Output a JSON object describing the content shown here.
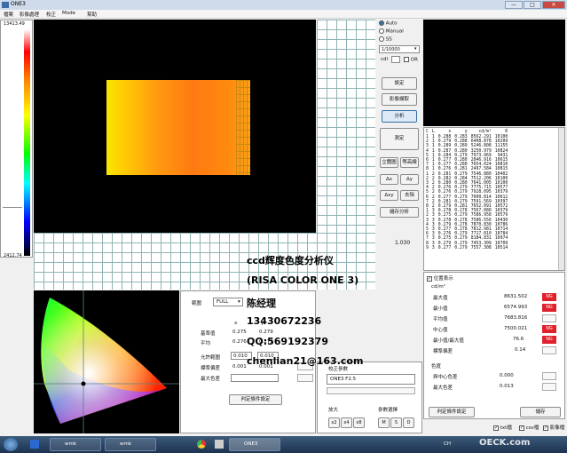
{
  "window": {
    "title": "ONE3",
    "min": "—",
    "max": "□",
    "close": "✕"
  },
  "menu": [
    "檔案",
    "影像處理",
    "校正",
    "Mode",
    "幫助"
  ],
  "scale": {
    "top": "13413.49",
    "bottom": "2412.74"
  },
  "mode": {
    "auto": "Auto",
    "manual": "Manual",
    "ss": "SS",
    "exposure": "1/10000",
    "cdl": "cdl",
    "or": "OR"
  },
  "buttons": {
    "set": "設定",
    "capture": "影像擷取",
    "analyze": "分析",
    "measure": "測定",
    "stereo": "立體圖",
    "contour": "等高線",
    "dx": "Δx",
    "dy": "Δy",
    "dxy": "Δxy",
    "delete": "去除",
    "save_img": "儲存分析",
    "custom_calc": "判定條件設定",
    "save": "儲存",
    "range_set": "判定條件設定"
  },
  "ratio": "1.030",
  "table": {
    "headers": [
      "C",
      "L",
      "x",
      "y",
      "cd/m²",
      "K"
    ],
    "rows": [
      [
        "1",
        "1",
        "0.288",
        "0.283",
        "8562.291",
        "10100"
      ],
      [
        "2",
        "1",
        "0.279",
        "0.288",
        "6408.878",
        "10209"
      ],
      [
        "3",
        "1",
        "0.289",
        "0.289",
        "5246.808",
        "11155"
      ],
      [
        "4",
        "1",
        "0.287",
        "0.280",
        "3250.979",
        "10824"
      ],
      [
        "5",
        "1",
        "0.284",
        "0.279",
        "7973.969",
        "9431"
      ],
      [
        "6",
        "1",
        "0.277",
        "0.280",
        "2846.916",
        "10615"
      ],
      [
        "7",
        "1",
        "0.277",
        "0.280",
        "7654.024",
        "10810"
      ],
      [
        "8",
        "1",
        "0.276",
        "0.281",
        "2497.584",
        "10815"
      ],
      [
        "1",
        "2",
        "0.281",
        "0.279",
        "7546.880",
        "10402"
      ],
      [
        "2",
        "2",
        "0.282",
        "0.284",
        "7512.206",
        "10100"
      ],
      [
        "3",
        "2",
        "0.280",
        "0.280",
        "7641.005",
        "10100"
      ],
      [
        "4",
        "2",
        "0.276",
        "0.279",
        "7775.715",
        "10577"
      ],
      [
        "5",
        "2",
        "0.276",
        "0.279",
        "7928.095",
        "10379"
      ],
      [
        "6",
        "2",
        "0.277",
        "0.279",
        "7600.814",
        "10612"
      ],
      [
        "7",
        "2",
        "0.281",
        "0.279",
        "7591.569",
        "10397"
      ],
      [
        "8",
        "2",
        "0.279",
        "0.281",
        "7652.091",
        "10572"
      ],
      [
        "1",
        "3",
        "0.278",
        "0.278",
        "7567.080",
        "10379"
      ],
      [
        "2",
        "3",
        "0.275",
        "0.279",
        "7586.958",
        "10579"
      ],
      [
        "3",
        "3",
        "0.278",
        "0.278",
        "7586.556",
        "10430"
      ],
      [
        "4",
        "3",
        "0.279",
        "0.278",
        "7870.830",
        "10786"
      ],
      [
        "5",
        "3",
        "0.277",
        "0.278",
        "7812.981",
        "10714"
      ],
      [
        "6",
        "3",
        "0.276",
        "0.279",
        "7717.810",
        "10784"
      ],
      [
        "7",
        "3",
        "0.275",
        "0.279",
        "8184.831",
        "10974"
      ],
      [
        "8",
        "3",
        "0.279",
        "0.279",
        "7453.309",
        "10709"
      ],
      [
        "9",
        "3",
        "0.277",
        "0.279",
        "7557.308",
        "10514"
      ]
    ]
  },
  "stats": {
    "show_label": "位置表示",
    "unit": "cd/m²",
    "max_label": "最大值",
    "max_value": "8631.502",
    "max_flag": "NG",
    "min_label": "最小值",
    "min_value": "6574.993",
    "min_flag": "NG",
    "avg_label": "平均值",
    "avg_value": "7683.816",
    "center_label": "中心值",
    "center_value": "7500.021",
    "center_flag": "NG",
    "ratio_label": "最小值/最大值",
    "ratio_value": "76.6",
    "ratio_flag": "NG",
    "std_label": "標準偏差",
    "std_value": "0.14",
    "color_title": "色度",
    "center_color_label": "與中心色差",
    "center_color_value": "0.000",
    "max_color_label": "最大色差",
    "max_color_value": "0.013"
  },
  "analysis": {
    "range_label": "範圍",
    "range_value": "FULL",
    "x_label": "x",
    "y_label": "y",
    "avg_x": "0.275",
    "avg_y": "0.279",
    "avg_label": "基準值",
    "cct_label": "平均",
    "cct_x": "0.276",
    "cct_y": "0.279",
    "tol_label": "允許範圍",
    "tol_x": "0.010",
    "tol_y": "0.010",
    "std_label": "標準偏差",
    "std_x": "0.001",
    "std_y": "0.001",
    "maxdiff_label": "最大色差",
    "judge_btn": "判定條件設定"
  },
  "calib": {
    "title": "校正參數",
    "field": "ONE3 F2.5",
    "zoom_label": "放大",
    "zoom_opts": [
      "x2",
      "x4",
      "x8"
    ],
    "param_label": "參數選擇",
    "param_opts": [
      "M",
      "S",
      "D"
    ]
  },
  "bottom_checks": {
    "txt": "txt檔",
    "csv": "csv檔",
    "img": "影像檔"
  },
  "overlay": {
    "line1": "ccd辉度色度分析仪",
    "line2": "(RISA COLOR ONE 3)",
    "line3": "陈经理",
    "line4": "13430672236",
    "line5": "QQ:569192379",
    "line6": "chenlian21@163.com"
  },
  "taskbar": {
    "item1": "wmk",
    "item2": "wmk",
    "item3": "ONE3",
    "lang": "CH",
    "watermark": "OECK.com"
  },
  "colors": {
    "ng": "#e0202b",
    "accent": "#3a6ea5",
    "grid": "#8fb3b3"
  }
}
